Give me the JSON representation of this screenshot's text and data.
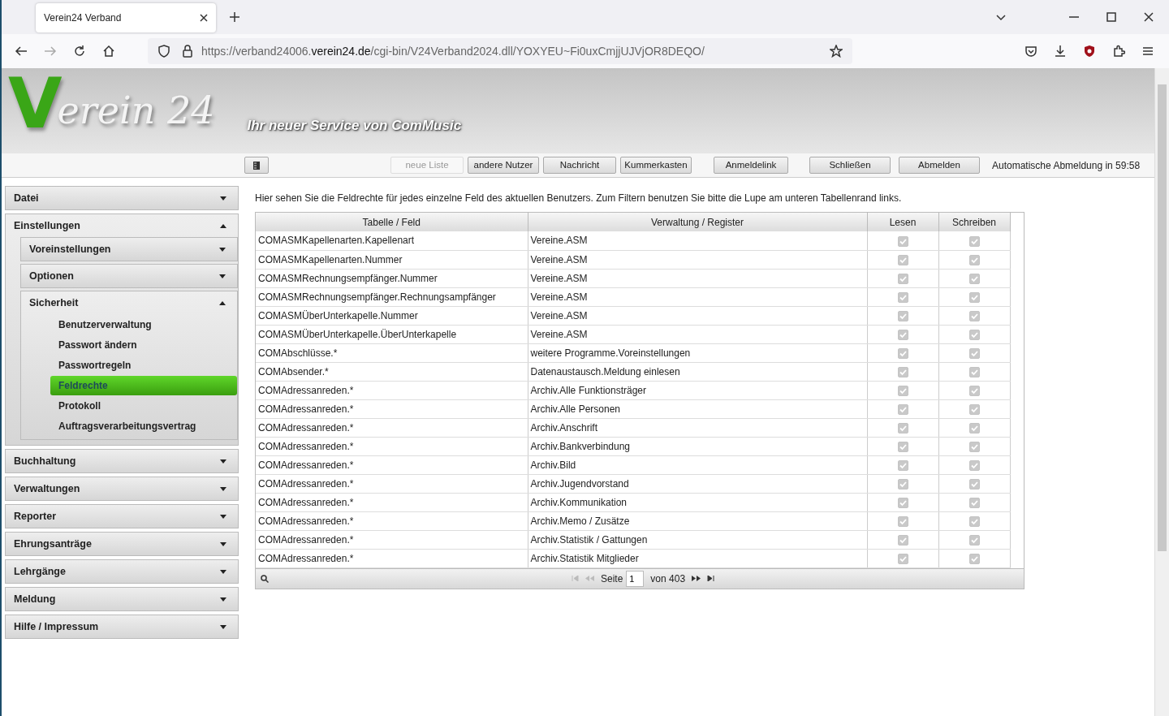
{
  "browser": {
    "tab_title": "Verein24 Verband",
    "url": {
      "prefix": "https://verband24006.",
      "domain": "verein24.de",
      "path": "/cgi-bin/V24Verband2024.dll/YOXYEU~Fi0uxCmjjUJVjOR8DEQO/"
    }
  },
  "header": {
    "logo_mark": "V",
    "logo_text": "erein 24",
    "tagline": "Ihr neuer Service von ComMusic"
  },
  "toolbar": {
    "buttons": [
      {
        "kind": "icon",
        "disabled": false
      },
      {
        "kind": "text",
        "label": "neue Liste",
        "disabled": true
      },
      {
        "kind": "text",
        "label": "andere Nutzer",
        "disabled": false
      },
      {
        "kind": "text",
        "label": "Nachricht",
        "disabled": false
      },
      {
        "kind": "text",
        "label": "Kummerkasten",
        "disabled": false
      },
      {
        "kind": "text",
        "label": "Anmeldelink",
        "disabled": false
      },
      {
        "kind": "text",
        "label": "Schließen",
        "disabled": false
      },
      {
        "kind": "text",
        "label": "Abmelden",
        "disabled": false
      }
    ],
    "logout_timer": "Automatische Abmeldung in 59:58"
  },
  "sidebar": {
    "items": [
      {
        "label": "Datei",
        "expanded": false
      },
      {
        "label": "Einstellungen",
        "expanded": true,
        "children": [
          {
            "label": "Voreinstellungen",
            "expanded": false
          },
          {
            "label": "Optionen",
            "expanded": false
          },
          {
            "label": "Sicherheit",
            "expanded": true,
            "children": [
              {
                "label": "Benutzerverwaltung",
                "selected": false
              },
              {
                "label": "Passwort ändern",
                "selected": false
              },
              {
                "label": "Passwortregeln",
                "selected": false
              },
              {
                "label": "Feldrechte",
                "selected": true
              },
              {
                "label": "Protokoll",
                "selected": false
              },
              {
                "label": "Auftragsverarbeitungsvertrag",
                "selected": false
              }
            ]
          }
        ]
      },
      {
        "label": "Buchhaltung",
        "expanded": false
      },
      {
        "label": "Verwaltungen",
        "expanded": false
      },
      {
        "label": "Reporter",
        "expanded": false
      },
      {
        "label": "Ehrungsanträge",
        "expanded": false
      },
      {
        "label": "Lehrgänge",
        "expanded": false
      },
      {
        "label": "Meldung",
        "expanded": false
      },
      {
        "label": "Hilfe / Impressum",
        "expanded": false
      }
    ]
  },
  "intro": "Hier sehen Sie die Feldrechte für jedes einzelne Feld des aktuellen Benutzers. Zum Filtern benutzen Sie bitte die Lupe am unteren Tabellenrand links.",
  "table": {
    "columns": [
      "Tabelle / Feld",
      "Verwaltung / Register",
      "Lesen",
      "Schreiben"
    ],
    "rows": [
      {
        "field": "COMASMKapellenarten.Kapellenart",
        "register": "Vereine.ASM",
        "read": true,
        "write": true
      },
      {
        "field": "COMASMKapellenarten.Nummer",
        "register": "Vereine.ASM",
        "read": true,
        "write": true
      },
      {
        "field": "COMASMRechnungsempfänger.Nummer",
        "register": "Vereine.ASM",
        "read": true,
        "write": true
      },
      {
        "field": "COMASMRechnungsempfänger.Rechnungsampfänger",
        "register": "Vereine.ASM",
        "read": true,
        "write": true
      },
      {
        "field": "COMASMÜberUnterkapelle.Nummer",
        "register": "Vereine.ASM",
        "read": true,
        "write": true
      },
      {
        "field": "COMASMÜberUnterkapelle.ÜberUnterkapelle",
        "register": "Vereine.ASM",
        "read": true,
        "write": true
      },
      {
        "field": "COMAbschlüsse.*",
        "register": "weitere Programme.Voreinstellungen",
        "read": true,
        "write": true
      },
      {
        "field": "COMAbsender.*",
        "register": "Datenaustausch.Meldung einlesen",
        "read": true,
        "write": true
      },
      {
        "field": "COMAdressanreden.*",
        "register": "Archiv.Alle Funktionsträger",
        "read": true,
        "write": true
      },
      {
        "field": "COMAdressanreden.*",
        "register": "Archiv.Alle Personen",
        "read": true,
        "write": true
      },
      {
        "field": "COMAdressanreden.*",
        "register": "Archiv.Anschrift",
        "read": true,
        "write": true
      },
      {
        "field": "COMAdressanreden.*",
        "register": "Archiv.Bankverbindung",
        "read": true,
        "write": true
      },
      {
        "field": "COMAdressanreden.*",
        "register": "Archiv.Bild",
        "read": true,
        "write": true
      },
      {
        "field": "COMAdressanreden.*",
        "register": "Archiv.Jugendvorstand",
        "read": true,
        "write": true
      },
      {
        "field": "COMAdressanreden.*",
        "register": "Archiv.Kommunikation",
        "read": true,
        "write": true
      },
      {
        "field": "COMAdressanreden.*",
        "register": "Archiv.Memo / Zusätze",
        "read": true,
        "write": true
      },
      {
        "field": "COMAdressanreden.*",
        "register": "Archiv.Statistik / Gattungen",
        "read": true,
        "write": true
      },
      {
        "field": "COMAdressanreden.*",
        "register": "Archiv.Statistik Mitglieder",
        "read": true,
        "write": true
      }
    ]
  },
  "pager": {
    "page_label": "Seite",
    "page": "1",
    "total": "von 403"
  }
}
